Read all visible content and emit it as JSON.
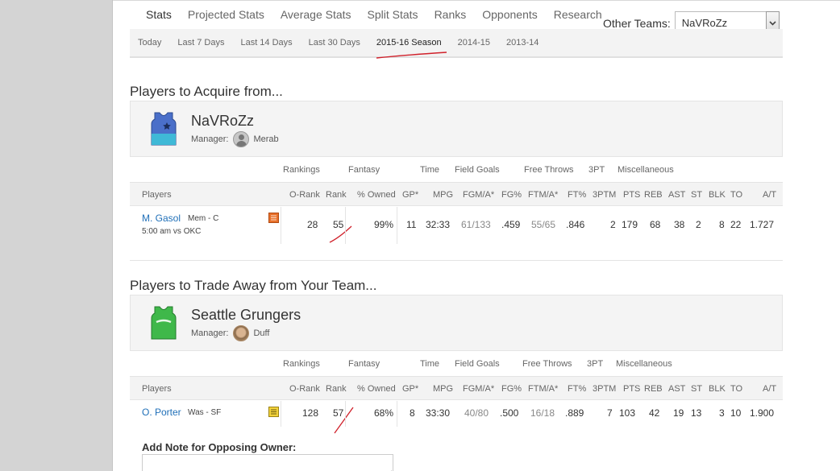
{
  "tabs": [
    "Stats",
    "Projected Stats",
    "Average Stats",
    "Split Stats",
    "Ranks",
    "Opponents",
    "Research"
  ],
  "other_teams": {
    "label": "Other Teams:",
    "selected": "NaVRoZz"
  },
  "subtabs": [
    "Today",
    "Last 7 Days",
    "Last 14 Days",
    "Last 30 Days",
    "2015-16 Season",
    "2014-15",
    "2013-14"
  ],
  "icons": {
    "dropdown": "chevron-down-icon",
    "note": "note-icon",
    "jersey_blue": "jersey-icon",
    "jersey_green": "jersey-icon",
    "avatar": "avatar-icon"
  },
  "colors": {
    "link": "#1f6fb8",
    "annotation": "#d0202a",
    "note_orange": "#e8702a",
    "note_yellow": "#f2d23a"
  },
  "acquire": {
    "title": "Players to Acquire from...",
    "team_name": "NaVRoZz",
    "manager_label": "Manager:",
    "manager_name": "Merab",
    "groups": {
      "rankings": "Rankings",
      "fantasy": "Fantasy",
      "time": "Time",
      "fg": "Field Goals",
      "ft": "Free Throws",
      "three": "3PT",
      "misc": "Miscellaneous"
    },
    "headers": {
      "players": "Players",
      "orank": "O-Rank",
      "rank": "Rank",
      "owned": "% Owned",
      "gp": "GP*",
      "mpg": "MPG",
      "fgma": "FGM/A*",
      "fgp": "FG%",
      "ftma": "FTM/A*",
      "ftp": "FT%",
      "tpm": "3PTM",
      "pts": "PTS",
      "reb": "REB",
      "ast": "AST",
      "st": "ST",
      "blk": "BLK",
      "to": "TO",
      "at": "A/T"
    },
    "player": {
      "name": "M. Gasol",
      "team_pos": "Mem - C",
      "game": "5:00 am vs OKC",
      "orank": "28",
      "rank": "55",
      "owned": "99%",
      "gp": "11",
      "mpg": "32:33",
      "fgma": "61/133",
      "fgp": ".459",
      "ftma": "55/65",
      "ftp": ".846",
      "tpm": "2",
      "pts": "179",
      "reb": "68",
      "ast": "38",
      "st": "2",
      "blk": "8",
      "to": "22",
      "at": "1.727"
    }
  },
  "trade": {
    "title": "Players to Trade Away from Your Team...",
    "team_name": "Seattle Grungers",
    "manager_label": "Manager:",
    "manager_name": "Duff",
    "groups": {
      "rankings": "Rankings",
      "fantasy": "Fantasy",
      "time": "Time",
      "fg": "Field Goals",
      "ft": "Free Throws",
      "three": "3PT",
      "misc": "Miscellaneous"
    },
    "headers": {
      "players": "Players",
      "orank": "O-Rank",
      "rank": "Rank",
      "owned": "% Owned",
      "gp": "GP*",
      "mpg": "MPG",
      "fgma": "FGM/A*",
      "fgp": "FG%",
      "ftma": "FTM/A*",
      "ftp": "FT%",
      "tpm": "3PTM",
      "pts": "PTS",
      "reb": "REB",
      "ast": "AST",
      "st": "ST",
      "blk": "BLK",
      "to": "TO",
      "at": "A/T"
    },
    "player": {
      "name": "O. Porter",
      "team_pos": "Was - SF",
      "orank": "128",
      "rank": "57",
      "owned": "68%",
      "gp": "8",
      "mpg": "33:30",
      "fgma": "40/80",
      "fgp": ".500",
      "ftma": "16/18",
      "ftp": ".889",
      "tpm": "7",
      "pts": "103",
      "reb": "42",
      "ast": "19",
      "st": "13",
      "blk": "3",
      "to": "10",
      "at": "1.900"
    }
  },
  "note": {
    "label": "Add Note for Opposing Owner:",
    "placeholder": ""
  }
}
